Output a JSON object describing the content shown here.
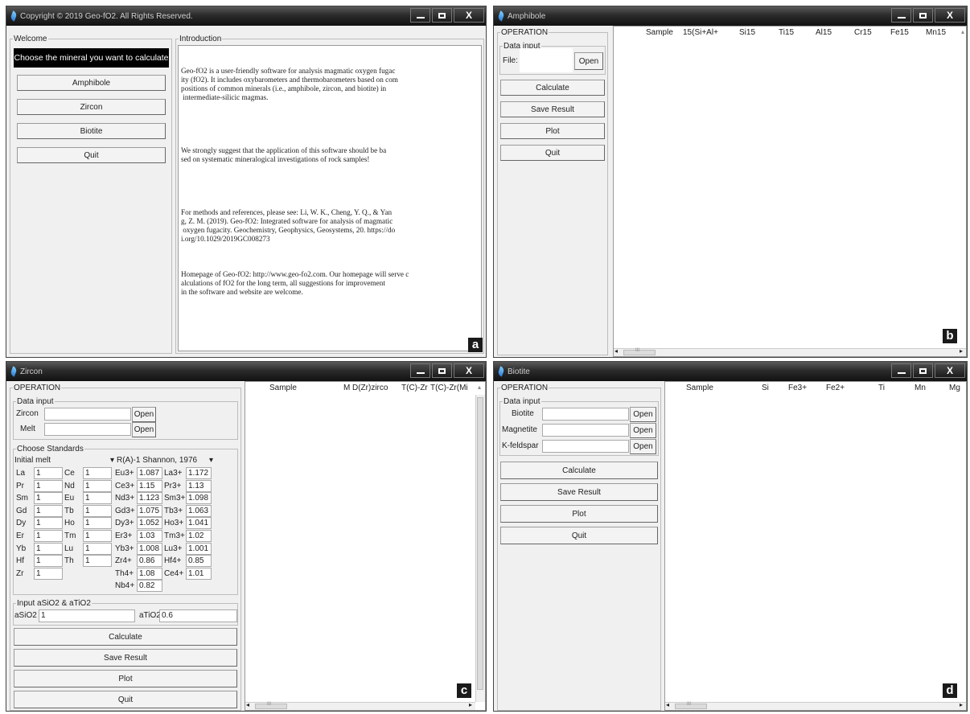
{
  "win_a": {
    "title": "Copyright © 2019 Geo-fO2. All Rights Reserved.",
    "welcome": {
      "legend": "Welcome",
      "prompt": "Choose the mineral you want to calculate",
      "buttons": [
        "Amphibole",
        "Zircon",
        "Biotite",
        "Quit"
      ]
    },
    "intro": {
      "legend": "Introduction",
      "paragraphs": [
        "Geo-fO2 is a user-friendly software for analysis magmatic oxygen fugac\nity (fO2). It includes oxybarometers and thermobarometers based on com\npositions of common minerals (i.e., amphibole, zircon, and biotite) in\n intermediate-silicic magmas.",
        "We strongly suggest that the application of this software should be ba\nsed on systematic mineralogical investigations of rock samples!",
        "For methods and references, please see: Li, W. K., Cheng, Y. Q., & Yan\ng, Z. M. (2019). Geo-fO2: Integrated software for analysis of magmatic\n oxygen fugacity. Geochemistry, Geophysics, Geosystems, 20. https://do\ni.org/10.1029/2019GC008273",
        "Homepage of Geo-fO2: http://www.geo-fo2.com. Our homepage will serve c\nalculations of fO2 for the long term, all suggestions for improvement\nin the software and website are welcome."
      ]
    },
    "badge": "a"
  },
  "win_b": {
    "title": "Amphibole",
    "operation": "OPERATION",
    "data_input": "Data input",
    "file_label": "File:",
    "open": "Open",
    "buttons": [
      "Calculate",
      "Save Result",
      "Plot",
      "Quit"
    ],
    "columns": [
      "Sample",
      "15(Si+Al+",
      "Si15",
      "Ti15",
      "Al15",
      "Cr15",
      "Fe15",
      "Mn15"
    ],
    "badge": "b"
  },
  "win_c": {
    "title": "Zircon",
    "operation": "OPERATION",
    "data_input": "Data input",
    "inputs": [
      {
        "label": "Zircon",
        "open": "Open"
      },
      {
        "label": "Melt",
        "open": "Open"
      }
    ],
    "standards_legend": "Choose Standards",
    "dropdown1": "Initial melt",
    "dropdown2": "R(A)-1 Shannon, 1976",
    "rows": [
      [
        {
          "l": "La",
          "v": "1"
        },
        {
          "l": "Ce",
          "v": "1"
        },
        {
          "l": "Eu3+",
          "v": "1.087"
        },
        {
          "l": "La3+",
          "v": "1.172"
        }
      ],
      [
        {
          "l": "Pr",
          "v": "1"
        },
        {
          "l": "Nd",
          "v": "1"
        },
        {
          "l": "Ce3+",
          "v": "1.15"
        },
        {
          "l": "Pr3+",
          "v": "1.13"
        }
      ],
      [
        {
          "l": "Sm",
          "v": "1"
        },
        {
          "l": "Eu",
          "v": "1"
        },
        {
          "l": "Nd3+",
          "v": "1.123"
        },
        {
          "l": "Sm3+",
          "v": "1.098"
        }
      ],
      [
        {
          "l": "Gd",
          "v": "1"
        },
        {
          "l": "Tb",
          "v": "1"
        },
        {
          "l": "Gd3+",
          "v": "1.075"
        },
        {
          "l": "Tb3+",
          "v": "1.063"
        }
      ],
      [
        {
          "l": "Dy",
          "v": "1"
        },
        {
          "l": "Ho",
          "v": "1"
        },
        {
          "l": "Dy3+",
          "v": "1.052"
        },
        {
          "l": "Ho3+",
          "v": "1.041"
        }
      ],
      [
        {
          "l": "Er",
          "v": "1"
        },
        {
          "l": "Tm",
          "v": "1"
        },
        {
          "l": "Er3+",
          "v": "1.03"
        },
        {
          "l": "Tm3+",
          "v": "1.02"
        }
      ],
      [
        {
          "l": "Yb",
          "v": "1"
        },
        {
          "l": "Lu",
          "v": "1"
        },
        {
          "l": "Yb3+",
          "v": "1.008"
        },
        {
          "l": "Lu3+",
          "v": "1.001"
        }
      ],
      [
        {
          "l": "Hf",
          "v": "1"
        },
        {
          "l": "Th",
          "v": "1"
        },
        {
          "l": "Zr4+",
          "v": "0.86"
        },
        {
          "l": "Hf4+",
          "v": "0.85"
        }
      ],
      [
        {
          "l": "Zr",
          "v": "1"
        },
        null,
        {
          "l": "Th4+",
          "v": "1.08"
        },
        {
          "l": "Ce4+",
          "v": "1.01"
        }
      ],
      [
        null,
        null,
        {
          "l": "Nb4+",
          "v": "0.82"
        },
        null
      ]
    ],
    "asio2_legend": "Input aSiO2 & aTiO2",
    "asio2_label": "aSiO2",
    "asio2_value": "1",
    "atio2_label": "aTiO2",
    "atio2_value": "0.6",
    "buttons": [
      "Calculate",
      "Save Result",
      "Plot",
      "Quit"
    ],
    "columns": [
      "Sample",
      "M",
      "D(Zr)zirco",
      "T(C)-Zr",
      "T(C)-Zr(Mi"
    ],
    "badge": "c"
  },
  "win_d": {
    "title": "Biotite",
    "operation": "OPERATION",
    "data_input": "Data input",
    "inputs": [
      {
        "label": "Biotite",
        "open": "Open"
      },
      {
        "label": "Magnetite",
        "open": "Open"
      },
      {
        "label": "K-feldspar",
        "open": "Open"
      }
    ],
    "buttons": [
      "Calculate",
      "Save Result",
      "Plot",
      "Quit"
    ],
    "columns": [
      "Sample",
      "Si",
      "Fe3+",
      "Fe2+",
      "Ti",
      "Mn",
      "Mg"
    ],
    "badge": "d"
  },
  "controls": {
    "close": "X"
  },
  "scroll_glyphs": {
    "left": "◂",
    "right": "▸",
    "up": "▴",
    "grip": "III"
  }
}
